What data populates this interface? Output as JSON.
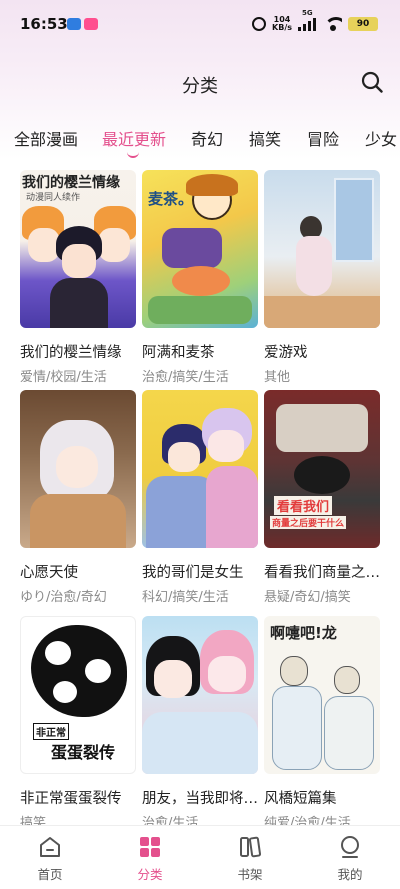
{
  "status_bar": {
    "time": "16:53",
    "net_speed_value": "104",
    "net_speed_unit": "KB/s",
    "network": "5G",
    "battery": "90"
  },
  "header": {
    "title": "分类",
    "search_icon": "search-icon"
  },
  "tabs": [
    "全部漫画",
    "最近更新",
    "奇幻",
    "搞笑",
    "冒险",
    "少女"
  ],
  "active_tab": "最近更新",
  "comics": [
    {
      "title": "我们的樱兰情缘",
      "tags": "爱情/校园/生活",
      "cover_text": "我们的樱兰情缘",
      "cover_sub": "动漫同人续作"
    },
    {
      "title": "阿满和麦茶",
      "tags": "治愈/搞笑/生活",
      "cover_text": "麦茶。"
    },
    {
      "title": "爱游戏",
      "tags": "其他"
    },
    {
      "title": "心愿天使",
      "tags": "ゆり/治愈/奇幻"
    },
    {
      "title": "我的哥们是女生",
      "tags": "科幻/搞笑/生活"
    },
    {
      "title": "看看我们商量之后要干什么",
      "tags": "悬疑/奇幻/搞笑",
      "cover_text": "看看我们",
      "cover_sub": "商量之后要干什么"
    },
    {
      "title": "非正常蛋蛋裂传",
      "tags": "搞笑",
      "cover_text": "蛋蛋裂传",
      "cover_sub": "非正常"
    },
    {
      "title": "朋友，当我即将离去",
      "tags": "治愈/生活"
    },
    {
      "title": "风橋短篇集",
      "tags": "纯爱/治愈/生活",
      "cover_text": "啊嚏吧!龙"
    }
  ],
  "bottom_nav": [
    {
      "label": "首页",
      "icon": "home-icon"
    },
    {
      "label": "分类",
      "icon": "category-icon"
    },
    {
      "label": "书架",
      "icon": "bookshelf-icon"
    },
    {
      "label": "我的",
      "icon": "profile-icon"
    }
  ],
  "colors": {
    "accent": "#e4508d",
    "text": "#222222",
    "tags": "#8a8a8a"
  }
}
